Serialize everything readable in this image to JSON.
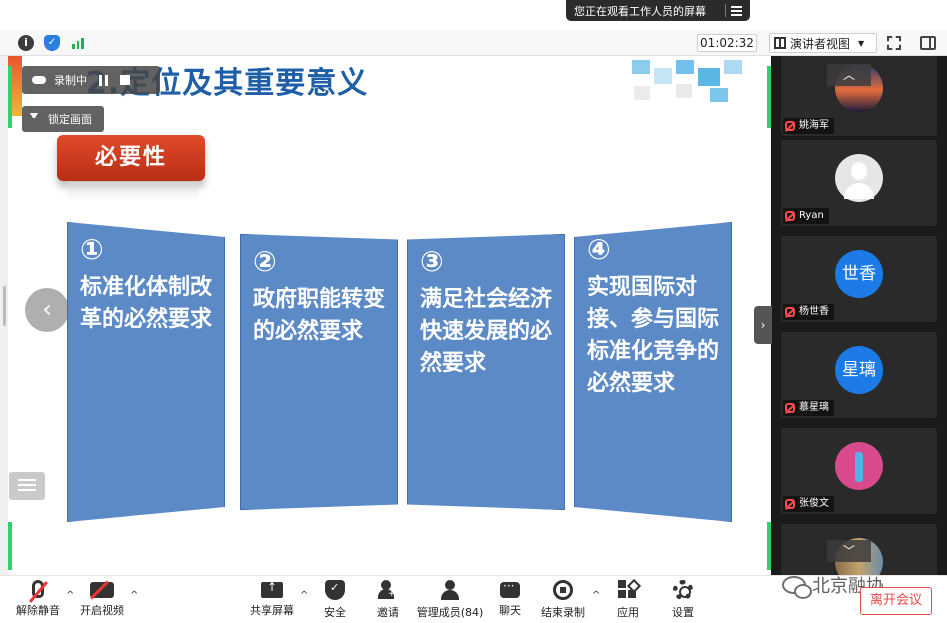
{
  "banner": {
    "text": "您正在观看工作人员的屏幕"
  },
  "toolbar": {
    "timer": "01:02:32",
    "view_label": "演讲者视图"
  },
  "recording": {
    "label": "录制中",
    "lock_label": "锁定画面"
  },
  "slide": {
    "title": "2.定位及其重要意义",
    "tag": "必要性",
    "panels": [
      {
        "num": "①",
        "text": "标准化体制改革的必然要求"
      },
      {
        "num": "②",
        "text": "政府职能转变的必然要求"
      },
      {
        "num": "③",
        "text": "满足社会经济快速发展的必然要求"
      },
      {
        "num": "④",
        "text": "实现国际对接、参与国际标准化竞争的必然要求"
      }
    ]
  },
  "participants": [
    {
      "name": "姚海军",
      "avatar": "sunset-photo"
    },
    {
      "name": "Ryan",
      "avatar": "default-avatar"
    },
    {
      "name": "杨世香",
      "avatar_text": "世香"
    },
    {
      "name": "慕星璃",
      "avatar_text": "星璃"
    },
    {
      "name": "张俊文",
      "avatar": "person-photo"
    }
  ],
  "controls": {
    "unmute": "解除静音",
    "start_video": "开启视频",
    "share_screen": "共享屏幕",
    "security": "安全",
    "invite": "邀请",
    "members": "管理成员(84)",
    "chat": "聊天",
    "end_record": "结束录制",
    "apps": "应用",
    "settings": "设置",
    "leave": "离开会议"
  },
  "watermark": {
    "text": "北京融协"
  },
  "colors": {
    "panel_blue": "#5b8ac7",
    "title_blue": "#1f5fa8",
    "tag_red": "#e04a2a",
    "leave_red": "#e84a4a",
    "avatar_blue": "#1c7be6"
  }
}
